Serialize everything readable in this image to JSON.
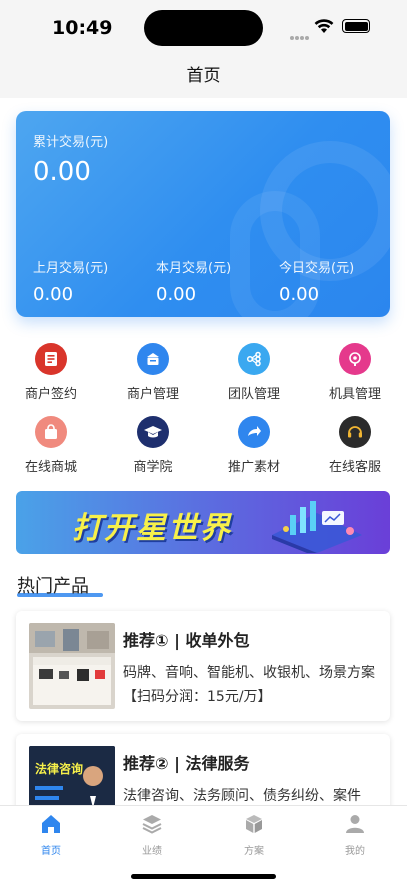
{
  "status_bar": {
    "time": "10:49"
  },
  "nav": {
    "title": "首页"
  },
  "stats": {
    "total_label": "累计交易(元)",
    "total_value": "0.00",
    "items": [
      {
        "label": "上月交易(元)",
        "value": "0.00"
      },
      {
        "label": "本月交易(元)",
        "value": "0.00"
      },
      {
        "label": "今日交易(元)",
        "value": "0.00"
      }
    ]
  },
  "grid": [
    {
      "label": "商户签约",
      "icon": "contract-icon",
      "color": "#d9352b"
    },
    {
      "label": "商户管理",
      "icon": "merchant-icon",
      "color": "#2f86ee"
    },
    {
      "label": "团队管理",
      "icon": "team-icon",
      "color": "#3aa8f0"
    },
    {
      "label": "机具管理",
      "icon": "device-icon",
      "color": "#e5398c"
    },
    {
      "label": "在线商城",
      "icon": "shop-bag-icon",
      "color": "#f08a7e"
    },
    {
      "label": "商学院",
      "icon": "graduation-cap-icon",
      "color": "#1e2f6e"
    },
    {
      "label": "推广素材",
      "icon": "share-icon",
      "color": "#2f86ee"
    },
    {
      "label": "在线客服",
      "icon": "headset-icon",
      "color": "#2b2b2b"
    }
  ],
  "banner": {
    "text": "打开星世界"
  },
  "section": {
    "title": "热门产品"
  },
  "products": [
    {
      "title": "推荐① | 收单外包",
      "desc": "码牌、音响、智能机、收银机、场景方案 【扫码分润：15元/万】",
      "thumb_caption": ""
    },
    {
      "title": "推荐② | 法律服务",
      "desc": "法律咨询、法务顾问、债务纠纷、案件",
      "thumb_caption": "法律咨询"
    }
  ],
  "tabs": [
    {
      "label": "首页",
      "icon": "home-icon",
      "active": true
    },
    {
      "label": "业绩",
      "icon": "layers-icon",
      "active": false
    },
    {
      "label": "方案",
      "icon": "box-icon",
      "active": false
    },
    {
      "label": "我的",
      "icon": "user-icon",
      "active": false
    }
  ],
  "colors": {
    "accent": "#2f86ee",
    "background": "#f5f5f5"
  }
}
